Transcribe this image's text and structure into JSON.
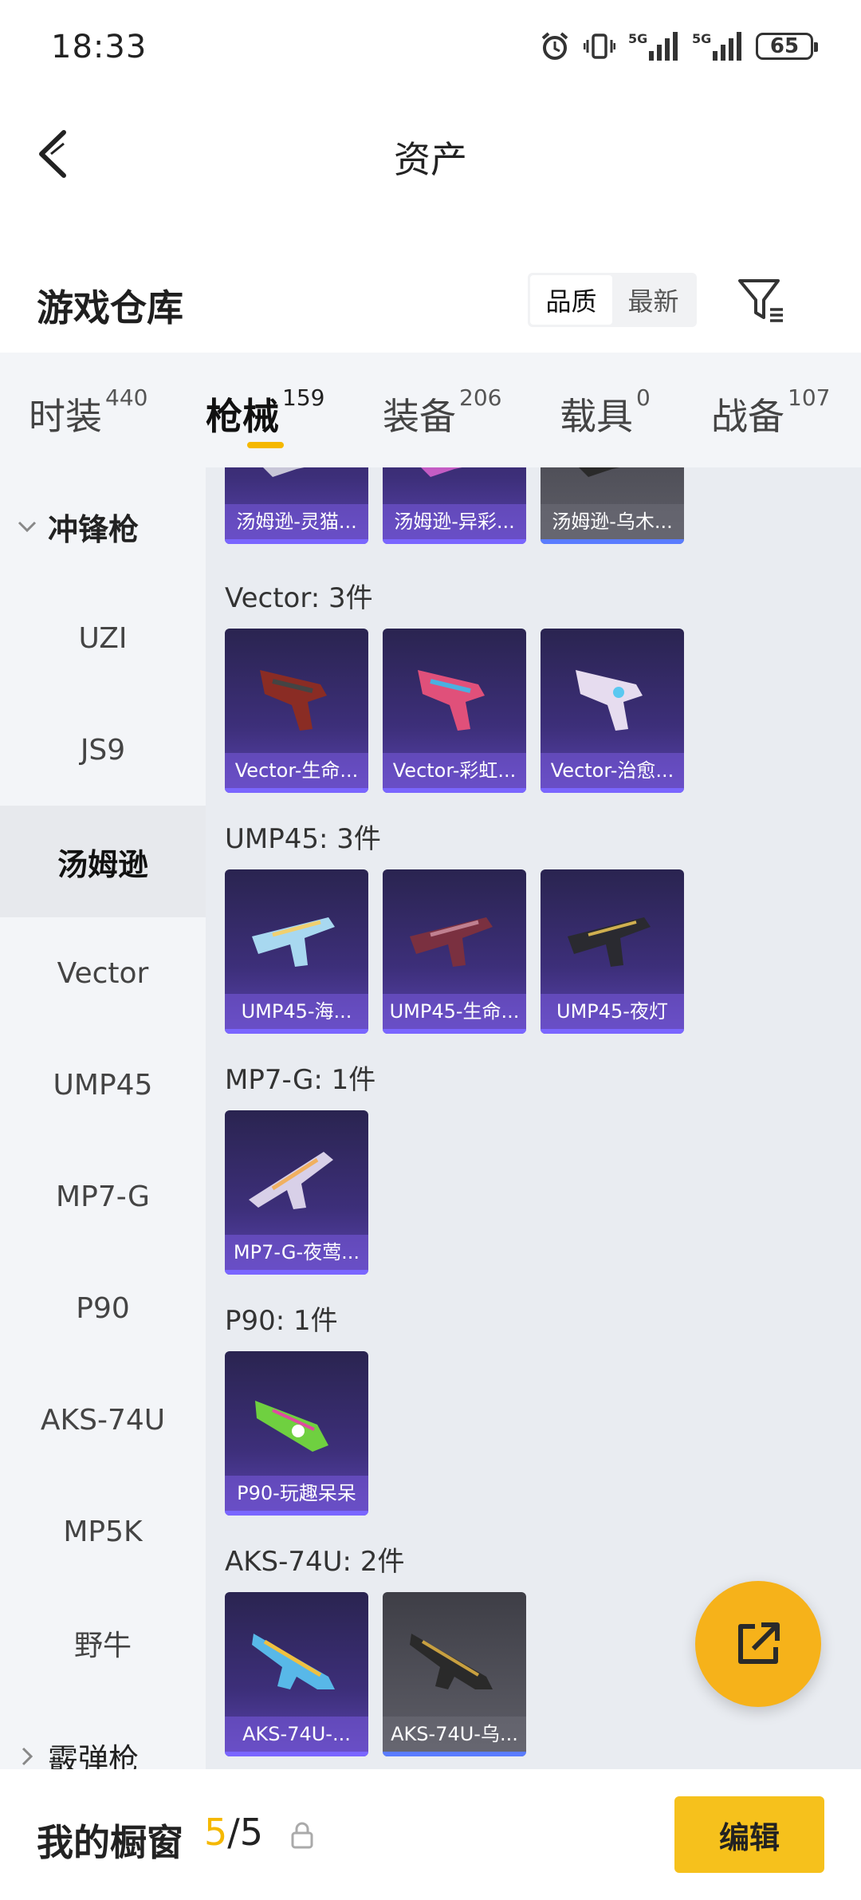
{
  "status_bar": {
    "time": "18:33",
    "battery": "65",
    "network_1": "5G",
    "network_2": "5G"
  },
  "nav": {
    "title": "资产"
  },
  "header": {
    "title": "游戏仓库",
    "sort_quality": "品质",
    "sort_latest": "最新"
  },
  "tabs": [
    {
      "label": "时装",
      "count": "440"
    },
    {
      "label": "枪械",
      "count": "159"
    },
    {
      "label": "装备",
      "count": "206"
    },
    {
      "label": "载具",
      "count": "0"
    },
    {
      "label": "战备",
      "count": "107"
    }
  ],
  "sidebar": {
    "group_open": "冲锋枪",
    "items": [
      "UZI",
      "JS9",
      "汤姆逊",
      "Vector",
      "UMP45",
      "MP7-G",
      "P90",
      "AKS-74U",
      "MP5K",
      "野牛"
    ],
    "active_item": "汤姆逊",
    "group_closed": "霰弹枪"
  },
  "sections": [
    {
      "title": "",
      "items": [
        {
          "name": "汤姆逊-灵猫..."
        },
        {
          "name": "汤姆逊-异彩..."
        },
        {
          "name": "汤姆逊-乌木..."
        }
      ]
    },
    {
      "title": "Vector: 3件",
      "items": [
        {
          "name": "Vector-生命..."
        },
        {
          "name": "Vector-彩虹..."
        },
        {
          "name": "Vector-治愈..."
        }
      ]
    },
    {
      "title": "UMP45: 3件",
      "items": [
        {
          "name": "UMP45-海..."
        },
        {
          "name": "UMP45-生命..."
        },
        {
          "name": "UMP45-夜灯"
        }
      ]
    },
    {
      "title": "MP7-G: 1件",
      "items": [
        {
          "name": "MP7-G-夜莺..."
        }
      ]
    },
    {
      "title": "P90: 1件",
      "items": [
        {
          "name": "P90-玩趣呆呆"
        }
      ]
    },
    {
      "title": "AKS-74U: 2件",
      "items": [
        {
          "name": "AKS-74U-..."
        },
        {
          "name": "AKS-74U-乌..."
        }
      ]
    }
  ],
  "bottom_bar": {
    "label": "我的橱窗",
    "count_current": "5",
    "count_sep_total": "/5",
    "edit_label": "编辑"
  },
  "colors": {
    "accent": "#f6c11c",
    "card_purple": "#3d2f7a",
    "card_grey": "#55555e"
  },
  "icons": {
    "back": "chevron-left-icon",
    "filter": "filter-icon",
    "share": "external-link-icon",
    "lock": "lock-icon"
  }
}
